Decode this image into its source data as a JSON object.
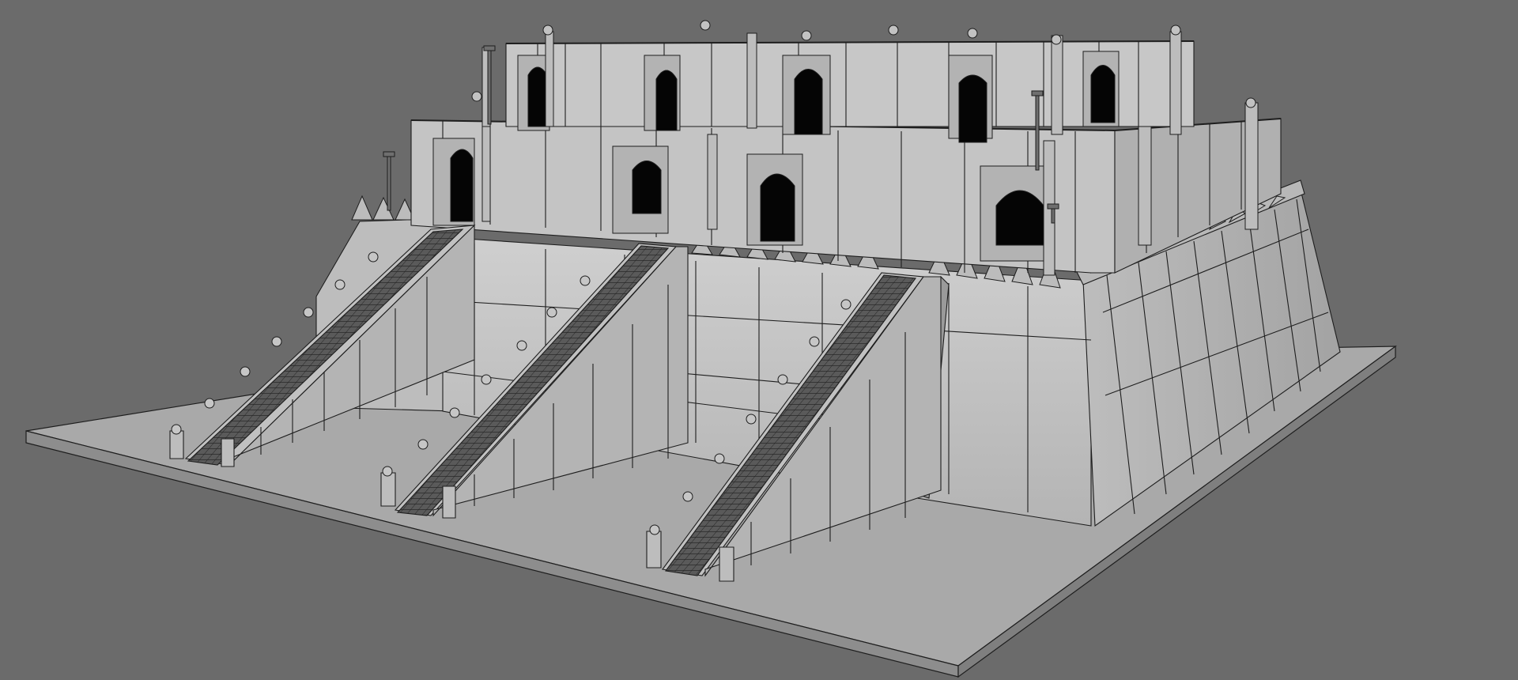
{
  "viewport": {
    "background": "#6b6b6b",
    "render_style": "wireframe-on-shaded",
    "wire_color": "#1e1e1e",
    "surface_light": "#c9c9c9",
    "surface_mid": "#a9a9a9",
    "surface_dark": "#8c8c8c",
    "opening_color": "#050505"
  },
  "scene": {
    "subject": "ziggurat-model",
    "tiers": 3,
    "staircases": 3
  }
}
